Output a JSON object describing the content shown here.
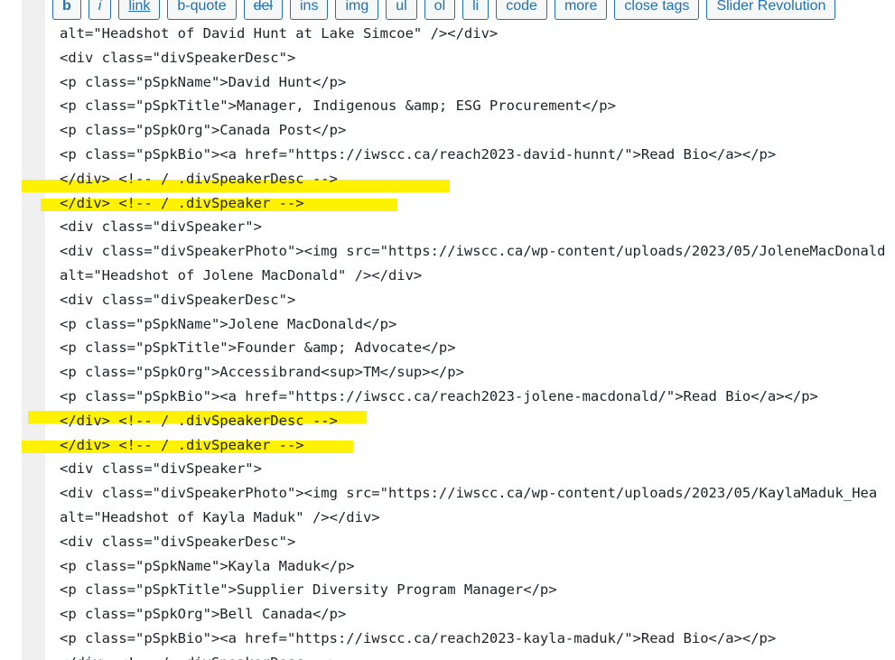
{
  "toolbar": {
    "buttons": [
      "b",
      "i",
      "link",
      "b-quote",
      "del",
      "ins",
      "img",
      "ul",
      "ol",
      "li",
      "code",
      "more",
      "close tags",
      "Slider Revolution"
    ]
  },
  "editor": {
    "highlight_color": "#fff200",
    "lines": [
      "alt=\"Headshot of David Hunt at Lake Simcoe\" /></div>",
      "<div class=\"divSpeakerDesc\">",
      "<p class=\"pSpkName\">David Hunt</p>",
      "<p class=\"pSpkTitle\">Manager, Indigenous &amp; ESG Procurement</p>",
      "<p class=\"pSpkOrg\">Canada Post</p>",
      "<p class=\"pSpkBio\"><a href=\"https://iwscc.ca/reach2023-david-hunnt/\">Read Bio</a></p>",
      "</div> <!-- / .divSpeakerDesc -->",
      "</div> <!-- / .divSpeaker -->",
      "<div class=\"divSpeaker\">",
      "<div class=\"divSpeakerPhoto\"><img src=\"https://iwscc.ca/wp-content/uploads/2023/05/JoleneMacDonald",
      "alt=\"Headshot of Jolene MacDonald\" /></div>",
      "<div class=\"divSpeakerDesc\">",
      "<p class=\"pSpkName\">Jolene MacDonald</p>",
      "<p class=\"pSpkTitle\">Founder &amp; Advocate</p>",
      "<p class=\"pSpkOrg\">Accessibrand<sup>TM</sup></p>",
      "<p class=\"pSpkBio\"><a href=\"https://iwscc.ca/reach2023-jolene-macdonald/\">Read Bio</a></p>",
      "</div> <!-- / .divSpeakerDesc -->",
      "</div> <!-- / .divSpeaker -->",
      "<div class=\"divSpeaker\">",
      "<div class=\"divSpeakerPhoto\"><img src=\"https://iwscc.ca/wp-content/uploads/2023/05/KaylaMaduk_Hea",
      "alt=\"Headshot of Kayla Maduk\" /></div>",
      "<div class=\"divSpeakerDesc\">",
      "<p class=\"pSpkName\">Kayla Maduk</p>",
      "<p class=\"pSpkTitle\">Supplier Diversity Program Manager</p>",
      "<p class=\"pSpkOrg\">Bell Canada</p>",
      "<p class=\"pSpkBio\"><a href=\"https://iwscc.ca/reach2023-kayla-maduk/\">Read Bio</a></p>",
      "</div> <!-- / .divSpeakerDesc -->"
    ]
  }
}
